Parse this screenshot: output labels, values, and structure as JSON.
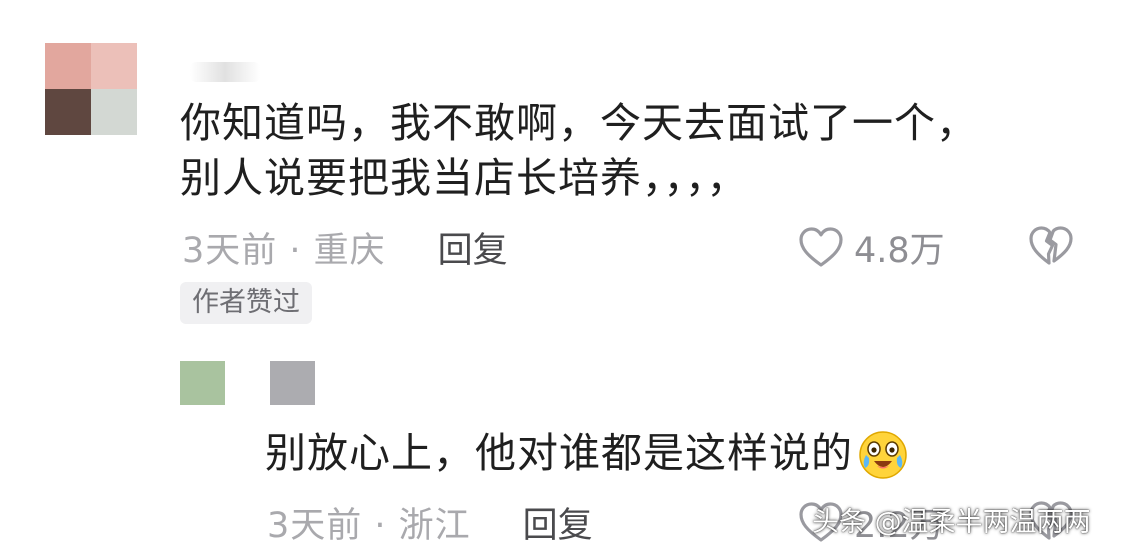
{
  "comment": {
    "lines": [
      "你知道吗，我不敢啊，今天去面试了一个，",
      "别人说要把我当店长培养，，，，"
    ],
    "time_location": "3天前 · 重庆",
    "reply_label": "回复",
    "like_count": "4.8万",
    "badge": "作者赞过",
    "avatar_colors": [
      "#e2a79e",
      "#ecc0b9",
      "#5f4740",
      "#d3d8d3"
    ]
  },
  "reply": {
    "text": "别放心上，他对谁都是这样说的",
    "emoji": "crying-laughing-emoji",
    "time_location": "3天前 · 浙江",
    "reply_label": "回复",
    "like_count": "2.2万",
    "avatar_colors": [
      "#a9c39f",
      "#acacb0"
    ]
  },
  "watermark": "头条 @温柔半两温两两",
  "colors": {
    "primary_text": "#1f1f1f",
    "meta_text": "#a9a9ad",
    "reply_button": "#4a4a4d",
    "badge_bg": "#f0f0f2",
    "icon_stroke": "#9a9aa0"
  }
}
